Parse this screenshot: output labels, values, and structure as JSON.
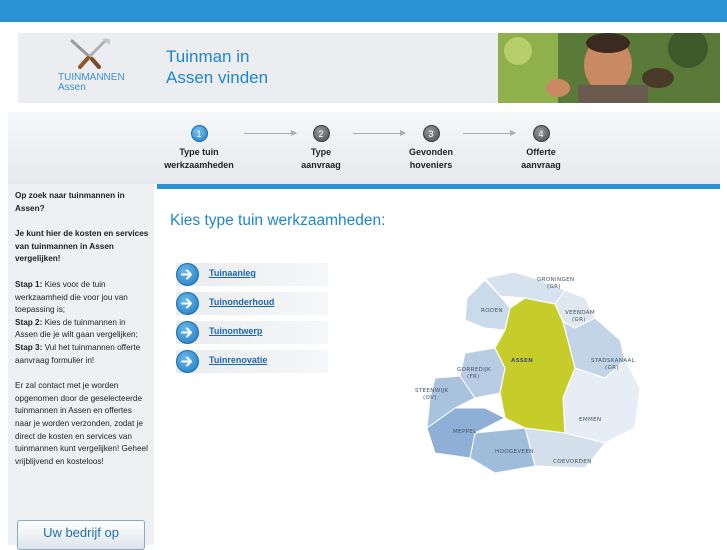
{
  "colors": {
    "accent": "#2b93d3",
    "title_blue": "#1e86cc",
    "selected_region": "#c6cd2a"
  },
  "logo": {
    "line1": "TUINMANNEN",
    "line2": "Assen",
    "icon": "garden-tools-icon"
  },
  "header": {
    "title_line1": "Tuinman in",
    "title_line2": "Assen vinden"
  },
  "steps": [
    {
      "number": "1",
      "line1": "Type tuin",
      "line2": "werkzaamheden",
      "active": true
    },
    {
      "number": "2",
      "line1": "Type",
      "line2": "aanvraag",
      "active": false
    },
    {
      "number": "3",
      "line1": "Gevonden",
      "line2": "hoveniers",
      "active": false
    },
    {
      "number": "4",
      "line1": "Offerte",
      "line2": "aanvraag",
      "active": false
    }
  ],
  "sidebar": {
    "question": "Op zoek naar tuinmannen in Assen?",
    "intro": "Je kunt hier de kosten en services van tuinmannen in Assen vergelijken!",
    "step1_label": "Stap 1:",
    "step1_text": " Kies voor de tuin werkzaamheid die voor jou van toepassing is;",
    "step2_label": "Stap 2:",
    "step2_text": " Kies de tuinmannen in Assen die je wilt gaan vergelijken;",
    "step3_label": "Stap 3:",
    "step3_text": " Vul het tuinmannen offerte aanvraag formulier in!",
    "contact": "Er zal contact met je worden opgenomen door de geselecteerde tuinmannen in Assen en offertes naar je worden verzonden, zodat je direct de kosten en services van tuinmannen kunt vergelijken! Geheel vrijblijvend en kosteloos!",
    "button_label": "Uw bedrijf op"
  },
  "main": {
    "title": "Kies type tuin werkzaamheden:",
    "options": [
      "Tuinaanleg",
      "Tuinonderhoud",
      "Tuinontwerp",
      "Tuinrenovatie"
    ]
  },
  "map": {
    "regions": {
      "groningen": "GRONINGEN",
      "groningen_sub": "(GR)",
      "roden": "RODEN",
      "veendam": "VEENDAM",
      "veendam_sub": "(GR)",
      "assen": "ASSEN",
      "stadskanaal": "STADSKANAAL",
      "stadskanaal_sub": "(GR)",
      "gorredijk": "GORREDIJK",
      "gorredijk_sub": "(FR)",
      "steenwijk": "STEENWIJK",
      "steenwijk_sub": "(OV)",
      "emmen": "EMMEN",
      "meppel": "MEPPEL",
      "hoogeveen": "HOOGEVEEN",
      "coevorden": "COEVORDEN"
    }
  }
}
